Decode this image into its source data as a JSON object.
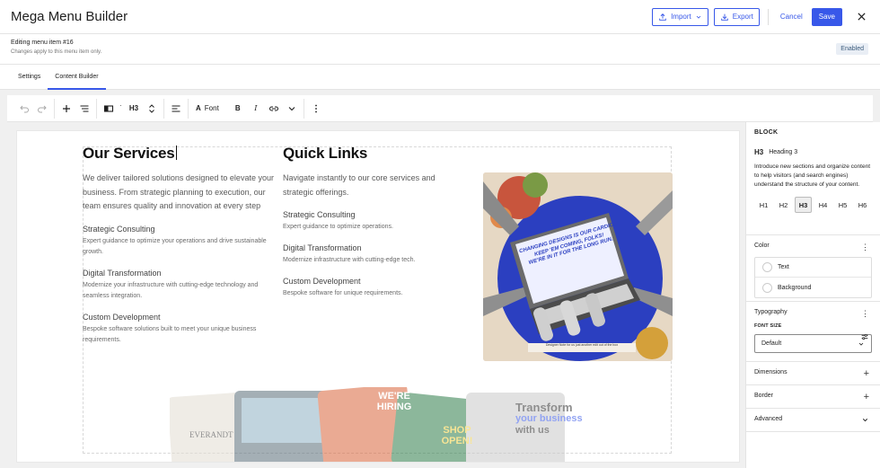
{
  "header": {
    "title": "Mega Menu Builder",
    "import_label": "Import",
    "export_label": "Export",
    "cancel_label": "Cancel",
    "save_label": "Save"
  },
  "info": {
    "editing": "Editing menu item #16",
    "note": "Changes apply to this menu item only.",
    "status": "Enabled"
  },
  "tabs": [
    {
      "label": "Settings",
      "active": false
    },
    {
      "label": "Content Builder",
      "active": true
    }
  ],
  "toolbar": {
    "heading_level": "H3",
    "font_label": "Font",
    "bold_label": "B",
    "italic_label": "I"
  },
  "content": {
    "services": {
      "heading": "Our Services",
      "intro": "We deliver tailored solutions designed to elevate your business. From strategic planning to execution, our team ensures quality and innovation at every step",
      "items": [
        {
          "title": "Strategic Consulting",
          "desc": "Expert guidance to optimize your operations and drive sustainable growth."
        },
        {
          "title": "Digital Transformation",
          "desc": "Modernize your infrastructure with cutting-edge technology and seamless integration."
        },
        {
          "title": "Custom Development",
          "desc": "Bespoke software solutions built to meet your unique business requirements."
        }
      ]
    },
    "links": {
      "heading": "Quick Links",
      "intro": "Navigate instantly to our core services and strategic offerings.",
      "items": [
        {
          "title": "Strategic Consulting",
          "desc": "Expert guidance to optimize operations."
        },
        {
          "title": "Digital Transformation",
          "desc": "Modernize infrastructure with cutting-edge tech."
        },
        {
          "title": "Custom Development",
          "desc": "Bespoke software for unique requirements."
        }
      ]
    },
    "image_text": {
      "screen_line1": "CHANGING DESIGNS IS OUR CARDIO.",
      "screen_line2": "KEEP 'EM COMING, FOLKS!",
      "screen_line3": "WE'RE IN IT FOR THE LONG RUN.",
      "caption": "Designer Note for us just another edit out of the box",
      "card_hiring": "WE'RE HIRING",
      "card_shop": "SHOP OPEN!",
      "card_transform_1": "Transform",
      "card_transform_2": "your business",
      "card_transform_3": "with us",
      "card_brand": "EVERANDT"
    }
  },
  "sidebar": {
    "block_title": "BLOCK",
    "heading_badge": "H3",
    "heading_name": "Heading 3",
    "description": "Introduce new sections and organize content to help visitors (and search engines) understand the structure of your content.",
    "levels": [
      "H1",
      "H2",
      "H3",
      "H4",
      "H5",
      "H6"
    ],
    "active_level": "H3",
    "color_label": "Color",
    "color_text": "Text",
    "color_background": "Background",
    "typography_label": "Typography",
    "font_size_label": "FONT SIZE",
    "font_size_value": "Default",
    "dimensions_label": "Dimensions",
    "border_label": "Border",
    "advanced_label": "Advanced"
  }
}
